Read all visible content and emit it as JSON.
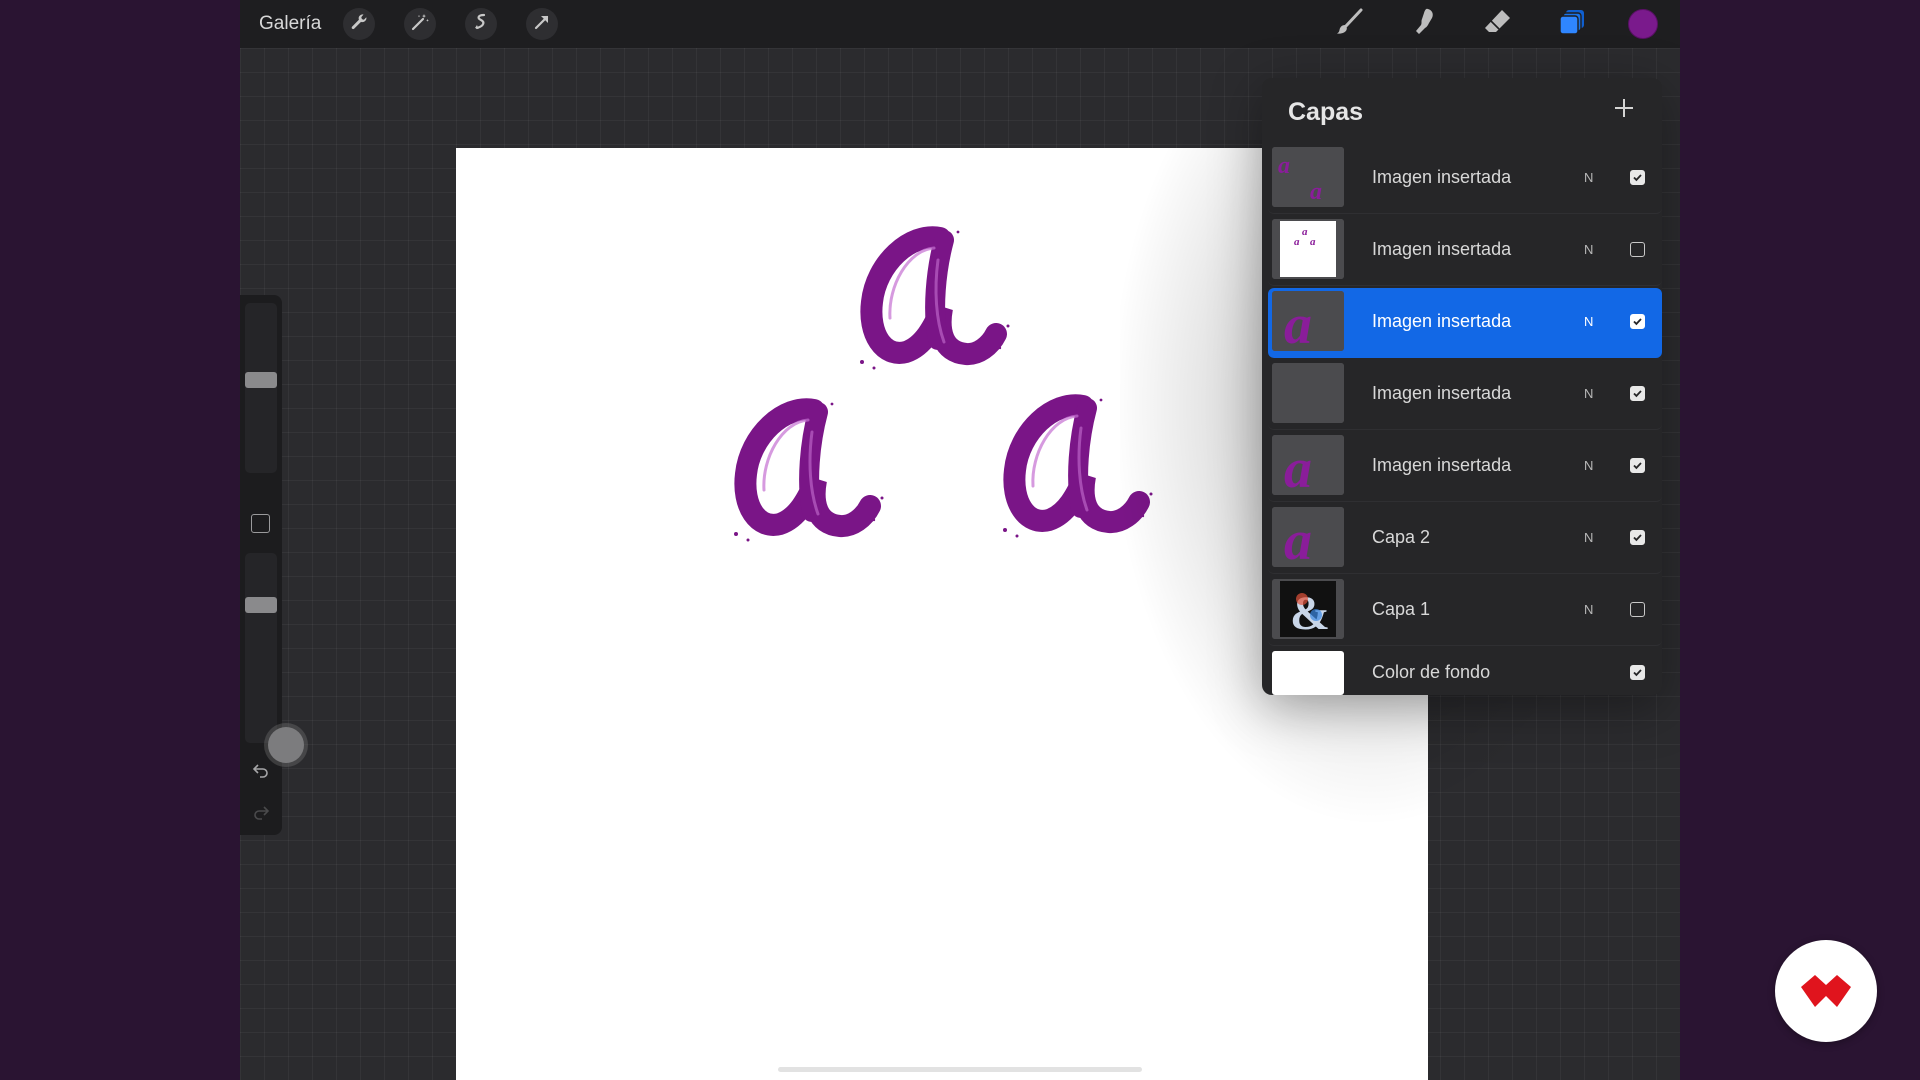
{
  "topbar": {
    "gallery_label": "Galería",
    "left_tools": [
      "wrench-icon",
      "magic-wand-icon",
      "selection-icon",
      "transform-arrow-icon"
    ],
    "right_tools": [
      "brush-icon",
      "smudge-icon",
      "eraser-icon",
      "layers-icon"
    ],
    "active_color": "#7a1a8c",
    "layers_accent": "#1a73e8"
  },
  "sidebar": {
    "brush_size_level": 0.55,
    "opacity_level": 0.75
  },
  "layers_panel": {
    "title": "Capas",
    "layers": [
      {
        "name": "Imagen insertada",
        "blend": "N",
        "visible": true,
        "selected": false,
        "thumb": "two-a"
      },
      {
        "name": "Imagen insertada",
        "blend": "N",
        "visible": false,
        "selected": false,
        "thumb": "three-a-white"
      },
      {
        "name": "Imagen insertada",
        "blend": "N",
        "visible": true,
        "selected": true,
        "thumb": "one-a"
      },
      {
        "name": "Imagen insertada",
        "blend": "N",
        "visible": true,
        "selected": false,
        "thumb": "empty"
      },
      {
        "name": "Imagen insertada",
        "blend": "N",
        "visible": true,
        "selected": false,
        "thumb": "one-a"
      },
      {
        "name": "Capa 2",
        "blend": "N",
        "visible": true,
        "selected": false,
        "thumb": "one-a"
      },
      {
        "name": "Capa 1",
        "blend": "N",
        "visible": false,
        "selected": false,
        "thumb": "ampersand"
      },
      {
        "name": "Color de fondo",
        "blend": "",
        "visible": true,
        "selected": false,
        "thumb": "white"
      }
    ]
  },
  "canvas": {
    "letter_color": "#7a1587"
  }
}
